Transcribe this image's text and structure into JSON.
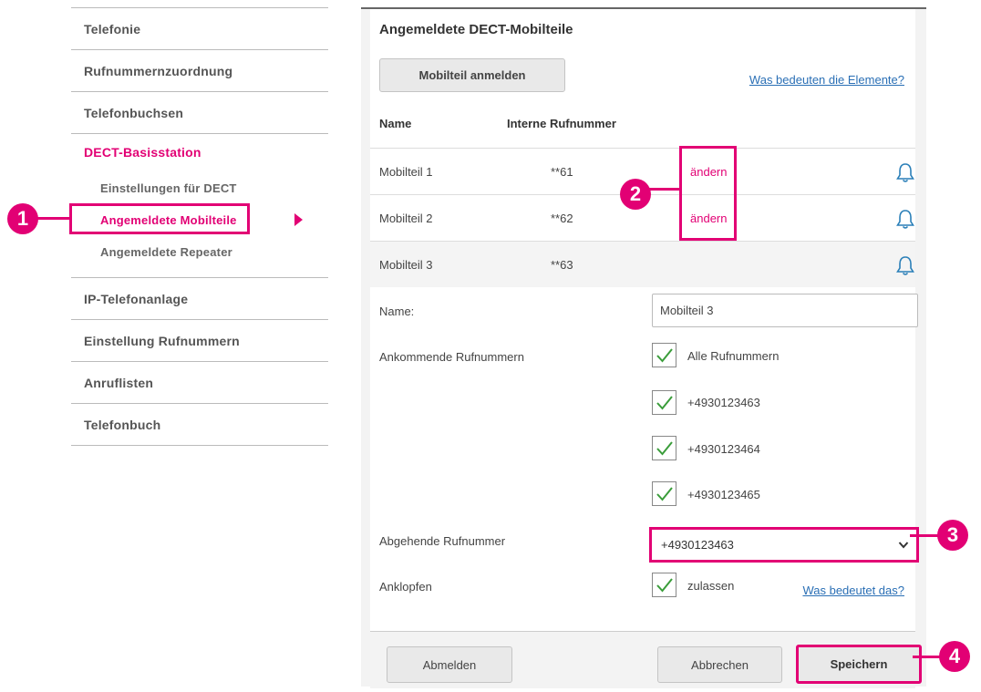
{
  "sidebar": {
    "items_top": [
      "Telefonie",
      "Rufnummernzuordnung",
      "Telefonbuchsen"
    ],
    "group": {
      "title": "DECT-Basisstation",
      "subitems": [
        "Einstellungen für DECT",
        "Angemeldete Mobilteile",
        "Angemeldete Repeater"
      ]
    },
    "items_bottom": [
      "IP-Telefonanlage",
      "Einstellung Rufnummern",
      "Anruflisten",
      "Telefonbuch"
    ]
  },
  "panel": {
    "title": "Angemeldete DECT-Mobilteile",
    "register_button": "Mobilteil anmelden",
    "help_link": "Was bedeuten die Elemente?",
    "col_name": "Name",
    "col_number": "Interne Rufnummer",
    "handsets": [
      {
        "name": "Mobilteil 1",
        "number": "**61",
        "edit": "ändern"
      },
      {
        "name": "Mobilteil 2",
        "number": "**62",
        "edit": "ändern"
      },
      {
        "name": "Mobilteil 3",
        "number": "**63"
      }
    ]
  },
  "form": {
    "name_label": "Name:",
    "name_value": "Mobilteil 3",
    "incoming_label": "Ankommende Rufnummern",
    "incoming": [
      {
        "label": "Alle Rufnummern",
        "checked": true
      },
      {
        "label": "+4930123463",
        "checked": true
      },
      {
        "label": "+4930123464",
        "checked": true
      },
      {
        "label": "+4930123465",
        "checked": true
      }
    ],
    "outgoing_label": "Abgehende Rufnummer",
    "outgoing_value": "+4930123463",
    "knock_label": "Anklopfen",
    "knock_option": "zulassen",
    "knock_help": "Was bedeutet das?"
  },
  "footer": {
    "logout": "Abmelden",
    "cancel": "Abbrechen",
    "save": "Speichern"
  },
  "callouts": [
    "1",
    "2",
    "3",
    "4"
  ],
  "colors": {
    "accent": "#e20074",
    "link": "#2a6fb5",
    "check": "#3a9d3a"
  }
}
